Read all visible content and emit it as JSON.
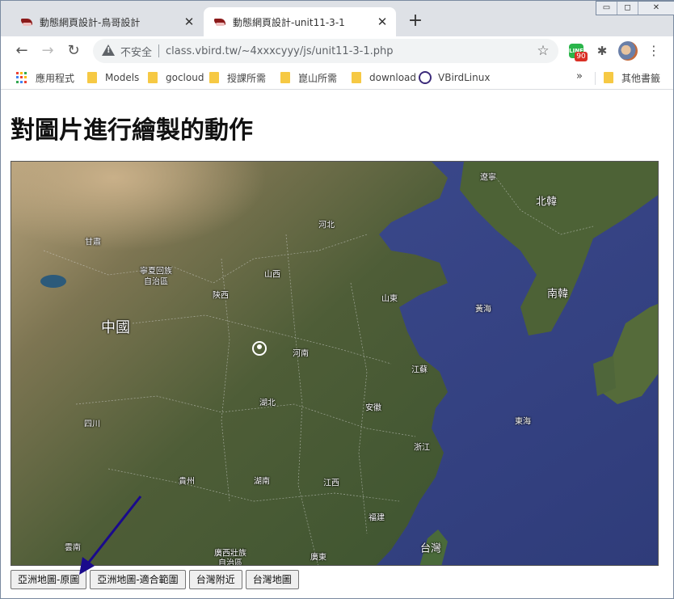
{
  "window_controls": {
    "minimize": "▭",
    "restore": "◻",
    "close": "✕"
  },
  "tabs": [
    {
      "title": "動態網頁設計-鳥哥設計",
      "close": "✕",
      "active": false
    },
    {
      "title": "動態網頁設計-unit11-3-1",
      "close": "✕",
      "active": true
    }
  ],
  "new_tab": "+",
  "toolbar": {
    "back": "←",
    "forward": "→",
    "reload": "↻",
    "insecure_label": "不安全",
    "url": "class.vbird.tw/~4xxxcyyy/js/unit11-3-1.php",
    "star": "☆",
    "line_ext_badge": "90",
    "line_ext_label": "LINE",
    "puzzle": "✱",
    "menu": "⋮"
  },
  "bookmarks": {
    "items": [
      {
        "label": "應用程式",
        "icon": "apps-icon"
      },
      {
        "label": "Models",
        "icon": "folder-icon"
      },
      {
        "label": "gocloud",
        "icon": "folder-icon"
      },
      {
        "label": "授課所需",
        "icon": "folder-icon"
      },
      {
        "label": "崑山所需",
        "icon": "folder-icon"
      },
      {
        "label": "download",
        "icon": "folder-icon"
      },
      {
        "label": "VBirdLinux",
        "icon": "vbird-icon"
      }
    ],
    "more": "»",
    "other": "其他書籤"
  },
  "page": {
    "heading": "對圖片進行繪製的動作",
    "map_labels": {
      "liaoning": "遼寧",
      "north_korea": "北韓",
      "hebei": "河北",
      "gansu": "甘肅",
      "ningxia_1": "寧夏回族",
      "ningxia_2": "自治區",
      "shanxi": "山西",
      "shaanxi": "陝西",
      "shandong": "山東",
      "yellow_sea": "黃海",
      "south_korea": "南韓",
      "china": "中國",
      "henan": "河南",
      "jiangsu": "江蘇",
      "hubei": "湖北",
      "anhui": "安徽",
      "east_sea": "東海",
      "sichuan": "四川",
      "zhejiang": "浙江",
      "guizhou": "貴州",
      "hunan": "湖南",
      "jiangxi": "江西",
      "fujian": "福建",
      "yunnan": "雲南",
      "guangxi_1": "廣西壯族",
      "guangxi_2": "自治區",
      "guangdong": "廣東",
      "taiwan": "台灣"
    },
    "buttons": {
      "original": "亞洲地圖-原圖",
      "fit": "亞洲地圖-適合範圍",
      "near_taiwan": "台灣附近",
      "taiwan_map": "台灣地圖"
    }
  },
  "colors": {
    "annotation_arrow": "#1a0a8c",
    "sea": "#3c4a8c",
    "land": "#4a5a38"
  }
}
